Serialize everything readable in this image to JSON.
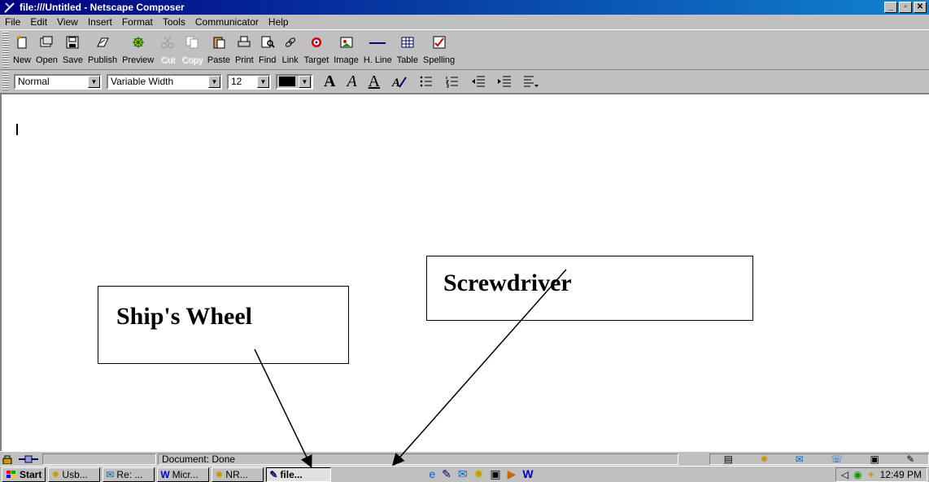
{
  "window": {
    "title": "file:///Untitled - Netscape Composer"
  },
  "menubar": {
    "items": [
      {
        "label": "File",
        "u": "F",
        "rest": "ile"
      },
      {
        "label": "Edit",
        "u": "E",
        "rest": "dit"
      },
      {
        "label": "View",
        "u": "V",
        "rest": "iew"
      },
      {
        "label": "Insert",
        "u": "I",
        "rest": "nsert"
      },
      {
        "label": "Format",
        "u": "o",
        "pre": "F",
        "rest": "rmat"
      },
      {
        "label": "Tools",
        "u": "T",
        "rest": "ools"
      },
      {
        "label": "Communicator",
        "u": "C",
        "rest": "ommunicator"
      },
      {
        "label": "Help",
        "u": "H",
        "rest": "elp"
      }
    ]
  },
  "toolbar": {
    "buttons": [
      {
        "label": "New",
        "icon": "new-page-icon",
        "enabled": true
      },
      {
        "label": "Open",
        "icon": "open-icon",
        "enabled": true
      },
      {
        "label": "Save",
        "icon": "save-icon",
        "enabled": true
      },
      {
        "label": "Publish",
        "icon": "publish-icon",
        "enabled": true
      },
      {
        "label": "Preview",
        "icon": "preview-icon",
        "enabled": true
      },
      {
        "label": "Cut",
        "icon": "cut-icon",
        "enabled": false
      },
      {
        "label": "Copy",
        "icon": "copy-icon",
        "enabled": false
      },
      {
        "label": "Paste",
        "icon": "paste-icon",
        "enabled": true
      },
      {
        "label": "Print",
        "icon": "print-icon",
        "enabled": true
      },
      {
        "label": "Find",
        "icon": "find-icon",
        "enabled": true
      },
      {
        "label": "Link",
        "icon": "link-icon",
        "enabled": true
      },
      {
        "label": "Target",
        "icon": "target-icon",
        "enabled": true
      },
      {
        "label": "Image",
        "icon": "image-icon",
        "enabled": true
      },
      {
        "label": "H. Line",
        "icon": "horizontal-line-icon",
        "enabled": true
      },
      {
        "label": "Table",
        "icon": "table-icon",
        "enabled": true
      },
      {
        "label": "Spelling",
        "icon": "spelling-icon",
        "enabled": true
      }
    ]
  },
  "format": {
    "paragraph_style": "Normal",
    "font": "Variable Width",
    "size": "12",
    "color": "#000000"
  },
  "statusbar": {
    "text": "Document: Done"
  },
  "taskbar": {
    "start": "Start",
    "tasks": [
      "Usb...",
      "Re: ...",
      "Micr...",
      "NR...",
      "file..."
    ],
    "clock": "12:49 PM"
  },
  "annotations": {
    "ships_wheel": "Ship's Wheel",
    "screwdriver": "Screwdriver"
  }
}
